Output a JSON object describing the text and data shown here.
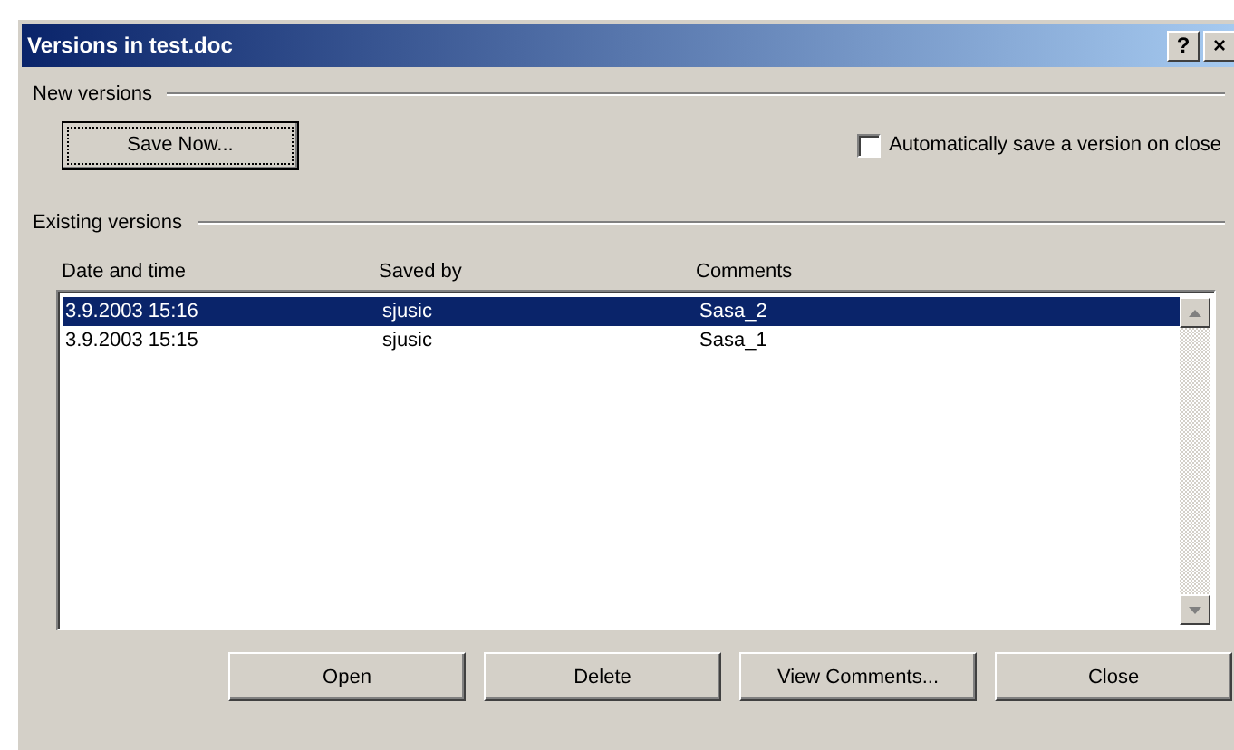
{
  "window": {
    "title": "Versions in test.doc",
    "title_buttons": [
      "?",
      "×"
    ]
  },
  "new_versions": {
    "heading": "New versions",
    "save_button": {
      "label": "Save Now...",
      "focused": true
    },
    "auto_save": {
      "label": "Automatically save a version on close",
      "checked": false
    }
  },
  "existing_versions": {
    "heading": "Existing versions",
    "columns": [
      {
        "label": "Date and time"
      },
      {
        "label": "Saved by"
      },
      {
        "label": "Comments"
      }
    ],
    "rows": [
      {
        "cells": [
          "3.9.2003 15:16",
          "sjusic",
          "Sasa_2"
        ],
        "selected": true
      },
      {
        "cells": [
          "3.9.2003 15:15",
          "sjusic",
          "Sasa_1"
        ],
        "selected": false
      }
    ]
  },
  "buttons": [
    {
      "label": "Open"
    },
    {
      "label": "Delete"
    },
    {
      "label": "View Comments..."
    },
    {
      "label": "Close"
    }
  ]
}
